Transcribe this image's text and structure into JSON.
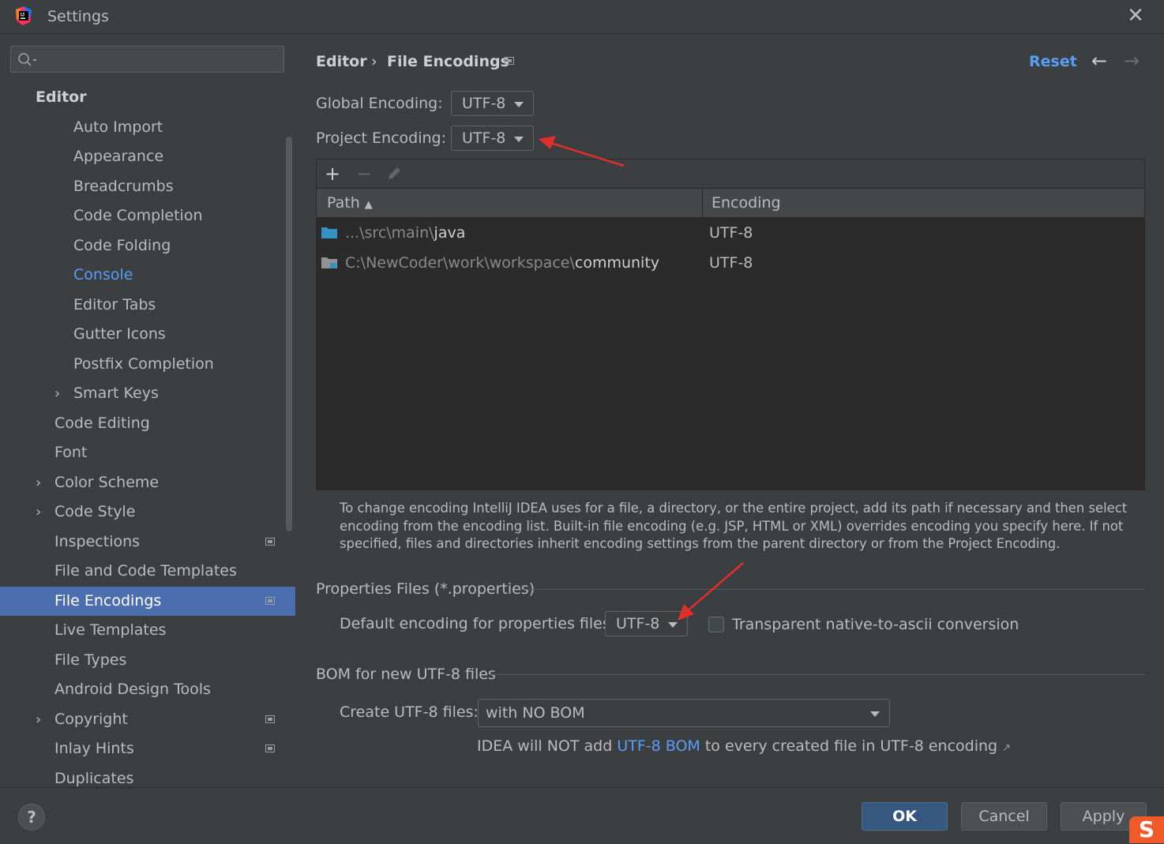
{
  "window": {
    "title": "Settings"
  },
  "sidebar": {
    "items": [
      {
        "label": "Editor",
        "level": 0,
        "bold": true
      },
      {
        "label": "Auto Import",
        "level": 2
      },
      {
        "label": "Appearance",
        "level": 2
      },
      {
        "label": "Breadcrumbs",
        "level": 2
      },
      {
        "label": "Code Completion",
        "level": 2
      },
      {
        "label": "Code Folding",
        "level": 2
      },
      {
        "label": "Console",
        "level": 2,
        "link": true
      },
      {
        "label": "Editor Tabs",
        "level": 2
      },
      {
        "label": "Gutter Icons",
        "level": 2
      },
      {
        "label": "Postfix Completion",
        "level": 2
      },
      {
        "label": "Smart Keys",
        "level": 2,
        "expandable": true
      },
      {
        "label": "Code Editing",
        "level": 1
      },
      {
        "label": "Font",
        "level": 1
      },
      {
        "label": "Color Scheme",
        "level": 1,
        "expandable": true
      },
      {
        "label": "Code Style",
        "level": 1,
        "expandable": true
      },
      {
        "label": "Inspections",
        "level": 1,
        "project_icon": true
      },
      {
        "label": "File and Code Templates",
        "level": 1
      },
      {
        "label": "File Encodings",
        "level": 1,
        "selected": true,
        "project_icon": true
      },
      {
        "label": "Live Templates",
        "level": 1
      },
      {
        "label": "File Types",
        "level": 1
      },
      {
        "label": "Android Design Tools",
        "level": 1
      },
      {
        "label": "Copyright",
        "level": 1,
        "expandable": true,
        "project_icon": true
      },
      {
        "label": "Inlay Hints",
        "level": 1,
        "project_icon": true
      },
      {
        "label": "Duplicates",
        "level": 1
      }
    ]
  },
  "header": {
    "breadcrumb_parent": "Editor",
    "breadcrumb_separator": "›",
    "breadcrumb_current": "File Encodings",
    "reset_label": "Reset"
  },
  "encoding": {
    "global_label": "Global Encoding:",
    "global_value": "UTF-8",
    "project_label": "Project Encoding:",
    "project_value": "UTF-8"
  },
  "table": {
    "col_path": "Path",
    "col_encoding": "Encoding",
    "rows": [
      {
        "path_dim": "...\\src\\main\\",
        "path_bright": "java",
        "encoding": "UTF-8"
      },
      {
        "path_dim": "C:\\NewCoder\\work\\workspace\\",
        "path_bright": "community",
        "encoding": "UTF-8"
      }
    ]
  },
  "help_text": "To change encoding IntelliJ IDEA uses for a file, a directory, or the entire project, add its path if necessary and then select encoding from the encoding list. Built-in file encoding (e.g. JSP, HTML or XML) overrides encoding you specify here. If not specified, files and directories inherit encoding settings from the parent directory or from the Project Encoding.",
  "properties": {
    "section_title": "Properties Files (*.properties)",
    "default_label": "Default encoding for properties files:",
    "default_value": "UTF-8",
    "transparent_label": "Transparent native-to-ascii conversion"
  },
  "bom": {
    "section_title": "BOM for new UTF-8 files",
    "create_label": "Create UTF-8 files:",
    "create_value": "with NO BOM",
    "note_before": "IDEA will NOT add ",
    "note_link": "UTF-8 BOM",
    "note_after": " to every created file in UTF-8 encoding"
  },
  "footer": {
    "help": "?",
    "ok": "OK",
    "cancel": "Cancel",
    "apply": "Apply"
  },
  "colors": {
    "background": "#3c3f41",
    "selection": "#4b6eaf",
    "link": "#589df6",
    "annotation_arrow": "#e0302b"
  }
}
